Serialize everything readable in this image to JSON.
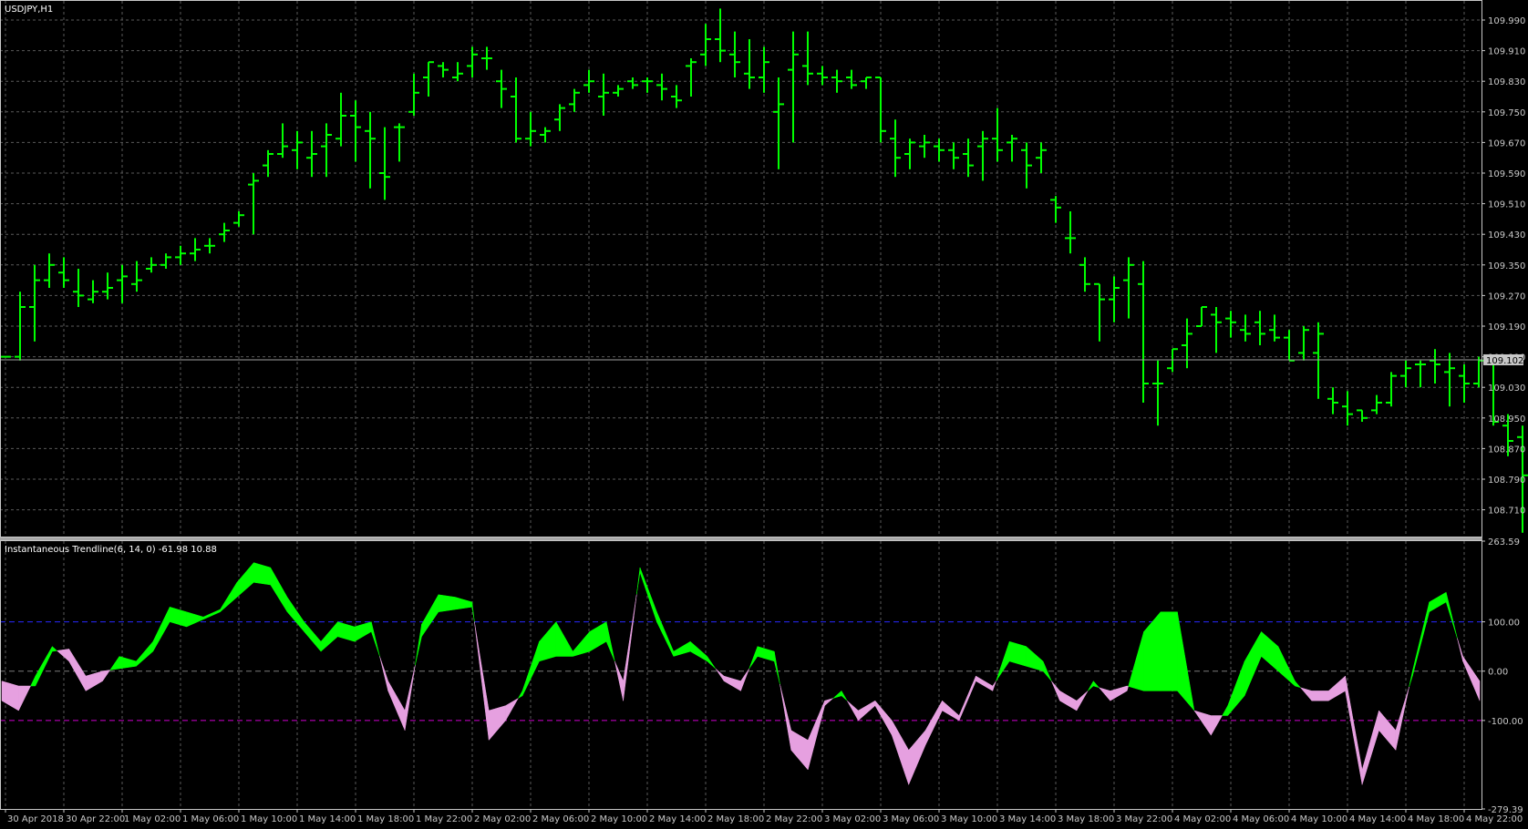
{
  "window": {
    "symbol_label": "USDJPY,H1",
    "indicator_label": "Instantaneous Trendline(6, 14, 0) -61.98 10.88",
    "current_price": "109.102",
    "colors": {
      "background": "#000000",
      "grid": "#5a5a5a",
      "axis_text": "#c8c8c8",
      "bars": "#00ff00",
      "bull_fill": "#00ff00",
      "bear_fill": "#e6a0e0",
      "level_high": "#2828ff",
      "level_zero": "#7a7a7a",
      "level_low": "#d000d0",
      "price_line": "#a0a0a0",
      "price_tag_bg": "#c8c8c8"
    }
  },
  "chart_data": [
    {
      "type": "ohlc",
      "title": "USDJPY,H1",
      "ylim": [
        108.64,
        110.04
      ],
      "y_ticks": [
        "109.990",
        "109.910",
        "109.830",
        "109.750",
        "109.670",
        "109.590",
        "109.510",
        "109.430",
        "109.350",
        "109.270",
        "109.190",
        "109.110",
        "109.030",
        "108.950",
        "108.870",
        "108.790",
        "108.710"
      ],
      "x_ticks": [
        "30 Apr 2018",
        "30 Apr 22:00",
        "1 May 02:00",
        "1 May 06:00",
        "1 May 10:00",
        "1 May 14:00",
        "1 May 18:00",
        "1 May 22:00",
        "2 May 02:00",
        "2 May 06:00",
        "2 May 10:00",
        "2 May 14:00",
        "2 May 18:00",
        "2 May 22:00",
        "3 May 02:00",
        "3 May 06:00",
        "3 May 10:00",
        "3 May 14:00",
        "3 May 18:00",
        "3 May 22:00",
        "4 May 02:00",
        "4 May 06:00",
        "4 May 10:00",
        "4 May 14:00",
        "4 May 18:00",
        "4 May 22:00"
      ],
      "x_tick_bar_index": [
        0,
        4,
        8,
        12,
        16,
        20,
        24,
        28,
        32,
        36,
        40,
        44,
        48,
        52,
        56,
        60,
        64,
        68,
        72,
        76,
        80,
        84,
        88,
        92,
        96,
        100
      ],
      "grid": true,
      "ohlc": [
        [
          109.11,
          109.11,
          109.11,
          109.11
        ],
        [
          109.11,
          109.28,
          109.1,
          109.24
        ],
        [
          109.24,
          109.35,
          109.15,
          109.31
        ],
        [
          109.31,
          109.38,
          109.29,
          109.35
        ],
        [
          109.33,
          109.37,
          109.29,
          109.31
        ],
        [
          109.28,
          109.34,
          109.24,
          109.27
        ],
        [
          109.26,
          109.31,
          109.25,
          109.28
        ],
        [
          109.28,
          109.33,
          109.26,
          109.29
        ],
        [
          109.31,
          109.35,
          109.25,
          109.32
        ],
        [
          109.3,
          109.36,
          109.28,
          109.31
        ],
        [
          109.34,
          109.37,
          109.33,
          109.35
        ],
        [
          109.35,
          109.38,
          109.34,
          109.37
        ],
        [
          109.37,
          109.4,
          109.35,
          109.38
        ],
        [
          109.38,
          109.42,
          109.36,
          109.39
        ],
        [
          109.4,
          109.42,
          109.38,
          109.4
        ],
        [
          109.43,
          109.46,
          109.41,
          109.44
        ],
        [
          109.46,
          109.49,
          109.45,
          109.48
        ],
        [
          109.56,
          109.59,
          109.43,
          109.57
        ],
        [
          109.61,
          109.65,
          109.58,
          109.64
        ],
        [
          109.64,
          109.72,
          109.63,
          109.66
        ],
        [
          109.65,
          109.7,
          109.6,
          109.67
        ],
        [
          109.63,
          109.7,
          109.58,
          109.64
        ],
        [
          109.66,
          109.72,
          109.58,
          109.69
        ],
        [
          109.68,
          109.8,
          109.66,
          109.74
        ],
        [
          109.74,
          109.78,
          109.62,
          109.71
        ],
        [
          109.7,
          109.75,
          109.55,
          109.68
        ],
        [
          109.59,
          109.71,
          109.52,
          109.58
        ],
        [
          109.71,
          109.72,
          109.62,
          109.71
        ],
        [
          109.75,
          109.85,
          109.74,
          109.8
        ],
        [
          109.84,
          109.88,
          109.79,
          109.88
        ],
        [
          109.87,
          109.88,
          109.84,
          109.86
        ],
        [
          109.84,
          109.88,
          109.83,
          109.85
        ],
        [
          109.87,
          109.92,
          109.84,
          109.9
        ],
        [
          109.89,
          109.92,
          109.86,
          109.89
        ],
        [
          109.83,
          109.86,
          109.76,
          109.81
        ],
        [
          109.79,
          109.84,
          109.67,
          109.68
        ],
        [
          109.68,
          109.75,
          109.66,
          109.7
        ],
        [
          109.69,
          109.71,
          109.67,
          109.7
        ],
        [
          109.73,
          109.77,
          109.7,
          109.76
        ],
        [
          109.77,
          109.81,
          109.75,
          109.8
        ],
        [
          109.82,
          109.86,
          109.8,
          109.83
        ],
        [
          109.79,
          109.85,
          109.74,
          109.8
        ],
        [
          109.8,
          109.82,
          109.79,
          109.81
        ],
        [
          109.83,
          109.84,
          109.81,
          109.82
        ],
        [
          109.83,
          109.84,
          109.8,
          109.83
        ],
        [
          109.82,
          109.85,
          109.78,
          109.81
        ],
        [
          109.79,
          109.82,
          109.76,
          109.78
        ],
        [
          109.87,
          109.89,
          109.79,
          109.88
        ],
        [
          109.9,
          109.98,
          109.87,
          109.94
        ],
        [
          109.94,
          110.02,
          109.88,
          109.91
        ],
        [
          109.9,
          109.96,
          109.84,
          109.88
        ],
        [
          109.85,
          109.94,
          109.81,
          109.84
        ],
        [
          109.84,
          109.92,
          109.8,
          109.88
        ],
        [
          109.75,
          109.84,
          109.6,
          109.77
        ],
        [
          109.86,
          109.96,
          109.67,
          109.9
        ],
        [
          109.87,
          109.96,
          109.82,
          109.85
        ],
        [
          109.85,
          109.87,
          109.82,
          109.84
        ],
        [
          109.84,
          109.86,
          109.8,
          109.83
        ],
        [
          109.84,
          109.86,
          109.81,
          109.82
        ],
        [
          109.83,
          109.84,
          109.81,
          109.84
        ],
        [
          109.84,
          109.84,
          109.67,
          109.7
        ],
        [
          109.68,
          109.73,
          109.58,
          109.63
        ],
        [
          109.64,
          109.68,
          109.6,
          109.67
        ],
        [
          109.66,
          109.69,
          109.63,
          109.67
        ],
        [
          109.66,
          109.68,
          109.62,
          109.65
        ],
        [
          109.65,
          109.67,
          109.6,
          109.63
        ],
        [
          109.64,
          109.68,
          109.58,
          109.61
        ],
        [
          109.66,
          109.7,
          109.57,
          109.68
        ],
        [
          109.68,
          109.76,
          109.62,
          109.65
        ],
        [
          109.67,
          109.69,
          109.62,
          109.68
        ],
        [
          109.65,
          109.67,
          109.55,
          109.61
        ],
        [
          109.63,
          109.67,
          109.59,
          109.65
        ],
        [
          109.52,
          109.53,
          109.46,
          109.5
        ],
        [
          109.42,
          109.49,
          109.38,
          109.42
        ],
        [
          109.35,
          109.37,
          109.28,
          109.3
        ],
        [
          109.3,
          109.3,
          109.15,
          109.26
        ],
        [
          109.26,
          109.32,
          109.2,
          109.29
        ],
        [
          109.31,
          109.37,
          109.21,
          109.35
        ],
        [
          109.3,
          109.36,
          108.99,
          109.04
        ],
        [
          109.04,
          109.1,
          108.93,
          109.04
        ],
        [
          109.08,
          109.13,
          109.07,
          109.13
        ],
        [
          109.14,
          109.21,
          109.08,
          109.17
        ],
        [
          109.19,
          109.24,
          109.19,
          109.24
        ],
        [
          109.22,
          109.24,
          109.12,
          109.2
        ],
        [
          109.21,
          109.23,
          109.16,
          109.2
        ],
        [
          109.18,
          109.22,
          109.15,
          109.17
        ],
        [
          109.2,
          109.23,
          109.14,
          109.17
        ],
        [
          109.18,
          109.22,
          109.15,
          109.16
        ],
        [
          109.16,
          109.18,
          109.1,
          109.1
        ],
        [
          109.12,
          109.19,
          109.1,
          109.18
        ],
        [
          109.12,
          109.2,
          109.0,
          109.17
        ],
        [
          109.0,
          109.03,
          108.96,
          108.99
        ],
        [
          108.98,
          109.02,
          108.93,
          108.96
        ],
        [
          108.97,
          108.97,
          108.94,
          108.95
        ],
        [
          108.97,
          109.01,
          108.96,
          108.99
        ],
        [
          108.99,
          109.07,
          108.98,
          109.06
        ],
        [
          109.06,
          109.1,
          109.03,
          109.08
        ],
        [
          109.09,
          109.1,
          109.03,
          109.09
        ],
        [
          109.1,
          109.13,
          109.04,
          109.09
        ],
        [
          109.07,
          109.12,
          108.98,
          109.08
        ],
        [
          109.06,
          109.09,
          108.99,
          109.04
        ],
        [
          109.04,
          109.11,
          109.03,
          109.1
        ],
        [
          109.09,
          109.11,
          108.93,
          108.94
        ],
        [
          108.93,
          108.96,
          108.85,
          108.89
        ],
        [
          108.9,
          108.93,
          108.65,
          108.8
        ],
        [
          108.8,
          109.21,
          108.8,
          109.2
        ],
        [
          109.2,
          109.25,
          109.04,
          109.1
        ],
        [
          109.13,
          109.28,
          109.11,
          109.16
        ],
        [
          109.15,
          109.2,
          109.09,
          109.1
        ],
        [
          108.97,
          109.12,
          108.95,
          109.09
        ],
        [
          109.09,
          109.13,
          108.97,
          109.11
        ],
        [
          109.11,
          109.16,
          109.09,
          109.11
        ],
        [
          109.09,
          109.12,
          109.05,
          109.1
        ],
        [
          109.1,
          109.13,
          109.01,
          109.09
        ]
      ]
    },
    {
      "type": "area",
      "title": "Instantaneous Trendline(6, 14, 0) -61.98 10.88",
      "ylim": [
        -279.39,
        263.59
      ],
      "y_ticks": [
        "263.59",
        "100.00",
        "0.00",
        "-100.00",
        "-279.39"
      ],
      "levels": [
        100,
        0,
        -100
      ],
      "series": [
        {
          "name": "Trendline",
          "values": [
            -60,
            -80,
            -10,
            50,
            20,
            -40,
            -20,
            30,
            20,
            60,
            130,
            120,
            110,
            125,
            180,
            220,
            210,
            150,
            100,
            60,
            100,
            90,
            100,
            -40,
            -120,
            95,
            155,
            150,
            140,
            -140,
            -100,
            -40,
            60,
            100,
            40,
            80,
            100,
            -60,
            210,
            120,
            40,
            60,
            30,
            -20,
            -40,
            50,
            40,
            -160,
            -200,
            -70,
            -40,
            -100,
            -70,
            -130,
            -230,
            -150,
            -80,
            -100,
            -20,
            -40,
            60,
            50,
            20,
            -60,
            -80,
            -20,
            -60,
            -40,
            80,
            120,
            120,
            -80,
            -130,
            -70,
            20,
            80,
            50,
            -20,
            -60,
            -60,
            -40,
            -230,
            -120,
            -160,
            0,
            140,
            160,
            20,
            -60
          ]
        },
        {
          "name": "Lag",
          "values": [
            -20,
            -30,
            -30,
            40,
            45,
            -10,
            0,
            5,
            10,
            40,
            100,
            90,
            105,
            120,
            150,
            180,
            175,
            120,
            80,
            40,
            70,
            60,
            80,
            -20,
            -80,
            70,
            120,
            125,
            130,
            -80,
            -70,
            -50,
            20,
            30,
            30,
            40,
            60,
            -20,
            200,
            100,
            30,
            40,
            20,
            -10,
            -20,
            30,
            20,
            -120,
            -140,
            -60,
            -50,
            -80,
            -60,
            -100,
            -160,
            -120,
            -60,
            -90,
            -10,
            -30,
            20,
            10,
            0,
            -40,
            -60,
            -30,
            -40,
            -30,
            -40,
            -40,
            -40,
            -80,
            -90,
            -90,
            -50,
            30,
            0,
            -30,
            -40,
            -40,
            -10,
            -200,
            -80,
            -120,
            -10,
            120,
            140,
            30,
            -20
          ]
        }
      ]
    }
  ]
}
